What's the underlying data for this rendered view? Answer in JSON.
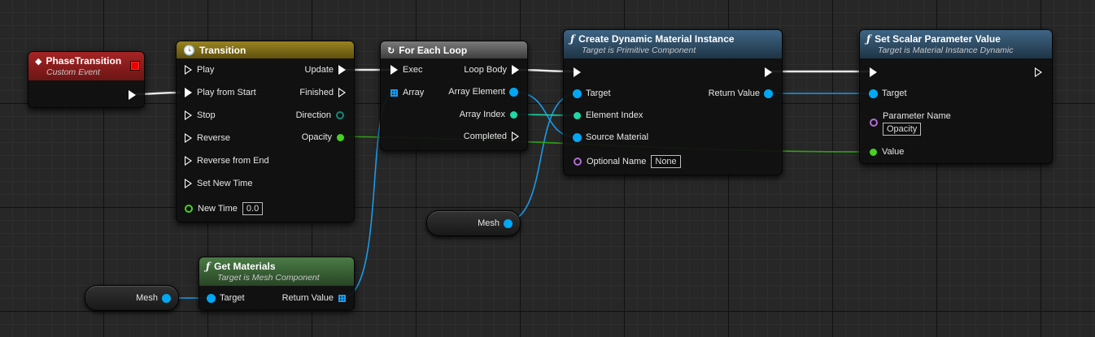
{
  "nodes": {
    "phase_transition": {
      "title": "PhaseTransition",
      "subtitle": "Custom Event"
    },
    "transition": {
      "title": "Transition",
      "inputs": [
        "Play",
        "Play from Start",
        "Stop",
        "Reverse",
        "Reverse from End",
        "Set New Time"
      ],
      "new_time_label": "New Time",
      "new_time_value": "0.0",
      "outputs": [
        "Update",
        "Finished",
        "Direction",
        "Opacity"
      ]
    },
    "for_each": {
      "title": "For Each Loop",
      "exec_in": "Exec",
      "array_in": "Array",
      "loop_body": "Loop Body",
      "array_element": "Array Element",
      "array_index": "Array Index",
      "completed": "Completed"
    },
    "create_dmi": {
      "title": "Create Dynamic Material Instance",
      "subtitle": "Target is Primitive Component",
      "target": "Target",
      "return_value": "Return Value",
      "element_index": "Element Index",
      "source_material": "Source Material",
      "optional_name": "Optional Name",
      "optional_name_value": "None"
    },
    "set_scalar": {
      "title": "Set Scalar Parameter Value",
      "subtitle": "Target is Material Instance Dynamic",
      "target": "Target",
      "parameter_name": "Parameter Name",
      "parameter_value": "Opacity",
      "value": "Value"
    },
    "get_materials": {
      "title": "Get Materials",
      "subtitle": "Target is Mesh Component",
      "target": "Target",
      "return_value": "Return Value"
    },
    "mesh_var_1": {
      "label": "Mesh"
    },
    "mesh_var_2": {
      "label": "Mesh"
    }
  },
  "colors": {
    "event_header": "#8a1d1d",
    "timeline_header": "#7e6a16",
    "macro_header": "#5c5c5c",
    "function_header": "#2f4f68",
    "pure_header": "#3f6a3a",
    "object_pin": "#00a8f4",
    "int_pin": "#1fd8a5",
    "float_pin": "#47d122",
    "name_pin": "#b06fd8"
  }
}
